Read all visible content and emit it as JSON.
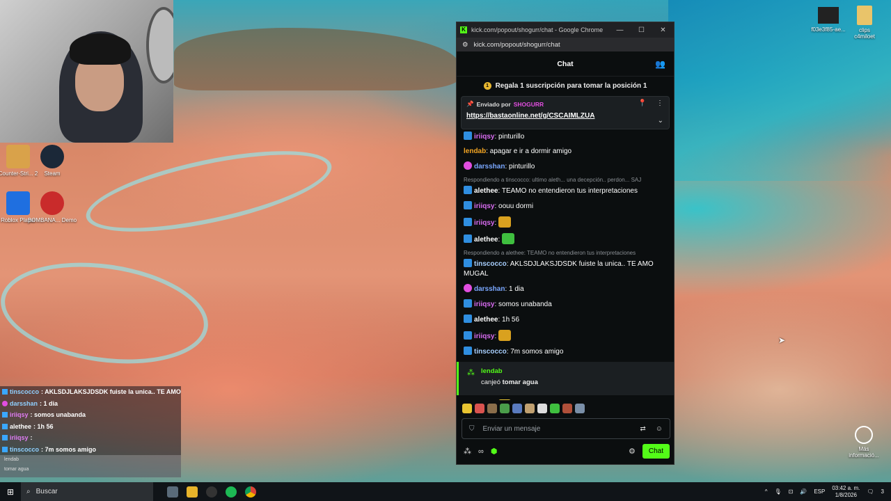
{
  "desktop": {
    "icons_left": [
      {
        "label": "Counter-Stri... 2",
        "icon": "counter-strike-icon"
      },
      {
        "label": "Steam",
        "icon": "steam-icon"
      },
      {
        "label": "Roblox Player",
        "icon": "roblox-icon"
      },
      {
        "label": "BOMBANA... Demo",
        "icon": "bombana-icon"
      }
    ],
    "icons_right": [
      {
        "label": "f03e3f85-ae...",
        "icon": "image-file-icon"
      },
      {
        "label": "clips c4miloet",
        "icon": "folder-icon"
      }
    ],
    "more_info_label": "Más informació..."
  },
  "overlay_chat": {
    "rows": [
      {
        "user": "tinscocco",
        "text": ": AKLSDJLAKSJDSDK fuiste la unica.. TE AMO"
      },
      {
        "user": "darsshan",
        "text": ": 1 dia"
      },
      {
        "user": "iriiqsy",
        "text": ": somos unabanda"
      },
      {
        "user": "alethee",
        "text": ": 1h 56"
      },
      {
        "user": "iriiqsy",
        "text": ":"
      },
      {
        "user": "tinscocco",
        "text": ": 7m somos amigo"
      }
    ],
    "redeem_user": "lendab",
    "redeem_text": "tomar agua",
    "last_user": "iriiqsy"
  },
  "browser": {
    "title": "kick.com/popout/shogurr/chat - Google Chrome",
    "url": "kick.com/popout/shogurr/chat",
    "controls": [
      "—",
      "☐",
      "✕"
    ]
  },
  "chat": {
    "header": "Chat",
    "gift_banner": "Regala 1 suscripción para tomar la posición 1",
    "gift_count": "1",
    "pinned": {
      "by_label": "Enviado por",
      "by_user": "SHOGURR",
      "link": "https://bastaonline.net/g/CSCAIMLZUA"
    },
    "messages": [
      {
        "user": "iriiqsy",
        "text": "pinturillo",
        "color": "#d96cf2"
      },
      {
        "user": "lendab",
        "text": "apagar e ir a dormir amigo",
        "color": "#f5a623",
        "nobadge": true
      },
      {
        "user": "darsshan",
        "text": "pinturillo",
        "color": "#7aa7ff",
        "pink": true
      },
      {
        "reply": "Respondiendo a tinscocco: ultimo aleth... una decepción.. perdon... SAJ"
      },
      {
        "user": "alethee",
        "text": "TEAMO no entendieron tus interpretaciones",
        "color": "#ffffff"
      },
      {
        "user": "iriiqsy",
        "text": "oouu dormi",
        "color": "#d96cf2"
      },
      {
        "user": "iriiqsy",
        "text": "",
        "color": "#d96cf2",
        "emote": "#d9a11f"
      },
      {
        "user": "alethee",
        "text": "",
        "color": "#ffffff",
        "emote": "#3fbf3f"
      },
      {
        "reply": "Respondiendo a alethee: TEAMO no entendieron tus interpretaciones"
      },
      {
        "user": "tinscocco",
        "text": "AKLSDJLAKSJDSDK fuiste la unica.. TE AMO MUGAL",
        "color": "#a9d0ff"
      },
      {
        "user": "darsshan",
        "text": "1 dia",
        "color": "#7aa7ff",
        "pink": true
      },
      {
        "user": "iriiqsy",
        "text": "somos unabanda",
        "color": "#d96cf2"
      },
      {
        "user": "alethee",
        "text": "1h 56",
        "color": "#ffffff"
      },
      {
        "user": "iriiqsy",
        "text": "",
        "color": "#d96cf2",
        "emote": "#d9a11f"
      },
      {
        "user": "tinscocco",
        "text": "7m somos amigo",
        "color": "#a9d0ff"
      }
    ],
    "redeem": {
      "user": "lendab",
      "verb": "canjeó",
      "reward": "tomar agua"
    },
    "last_message": {
      "user": "iriiqsy",
      "text": ""
    },
    "input_placeholder": "Enviar un mensaje",
    "send_label": "Chat",
    "bottom_count": "∞"
  },
  "taskbar": {
    "search_label": "Buscar",
    "language": "ESP",
    "time": "03:42 a. m.",
    "date": "1/8/2026",
    "notifications": "3"
  }
}
